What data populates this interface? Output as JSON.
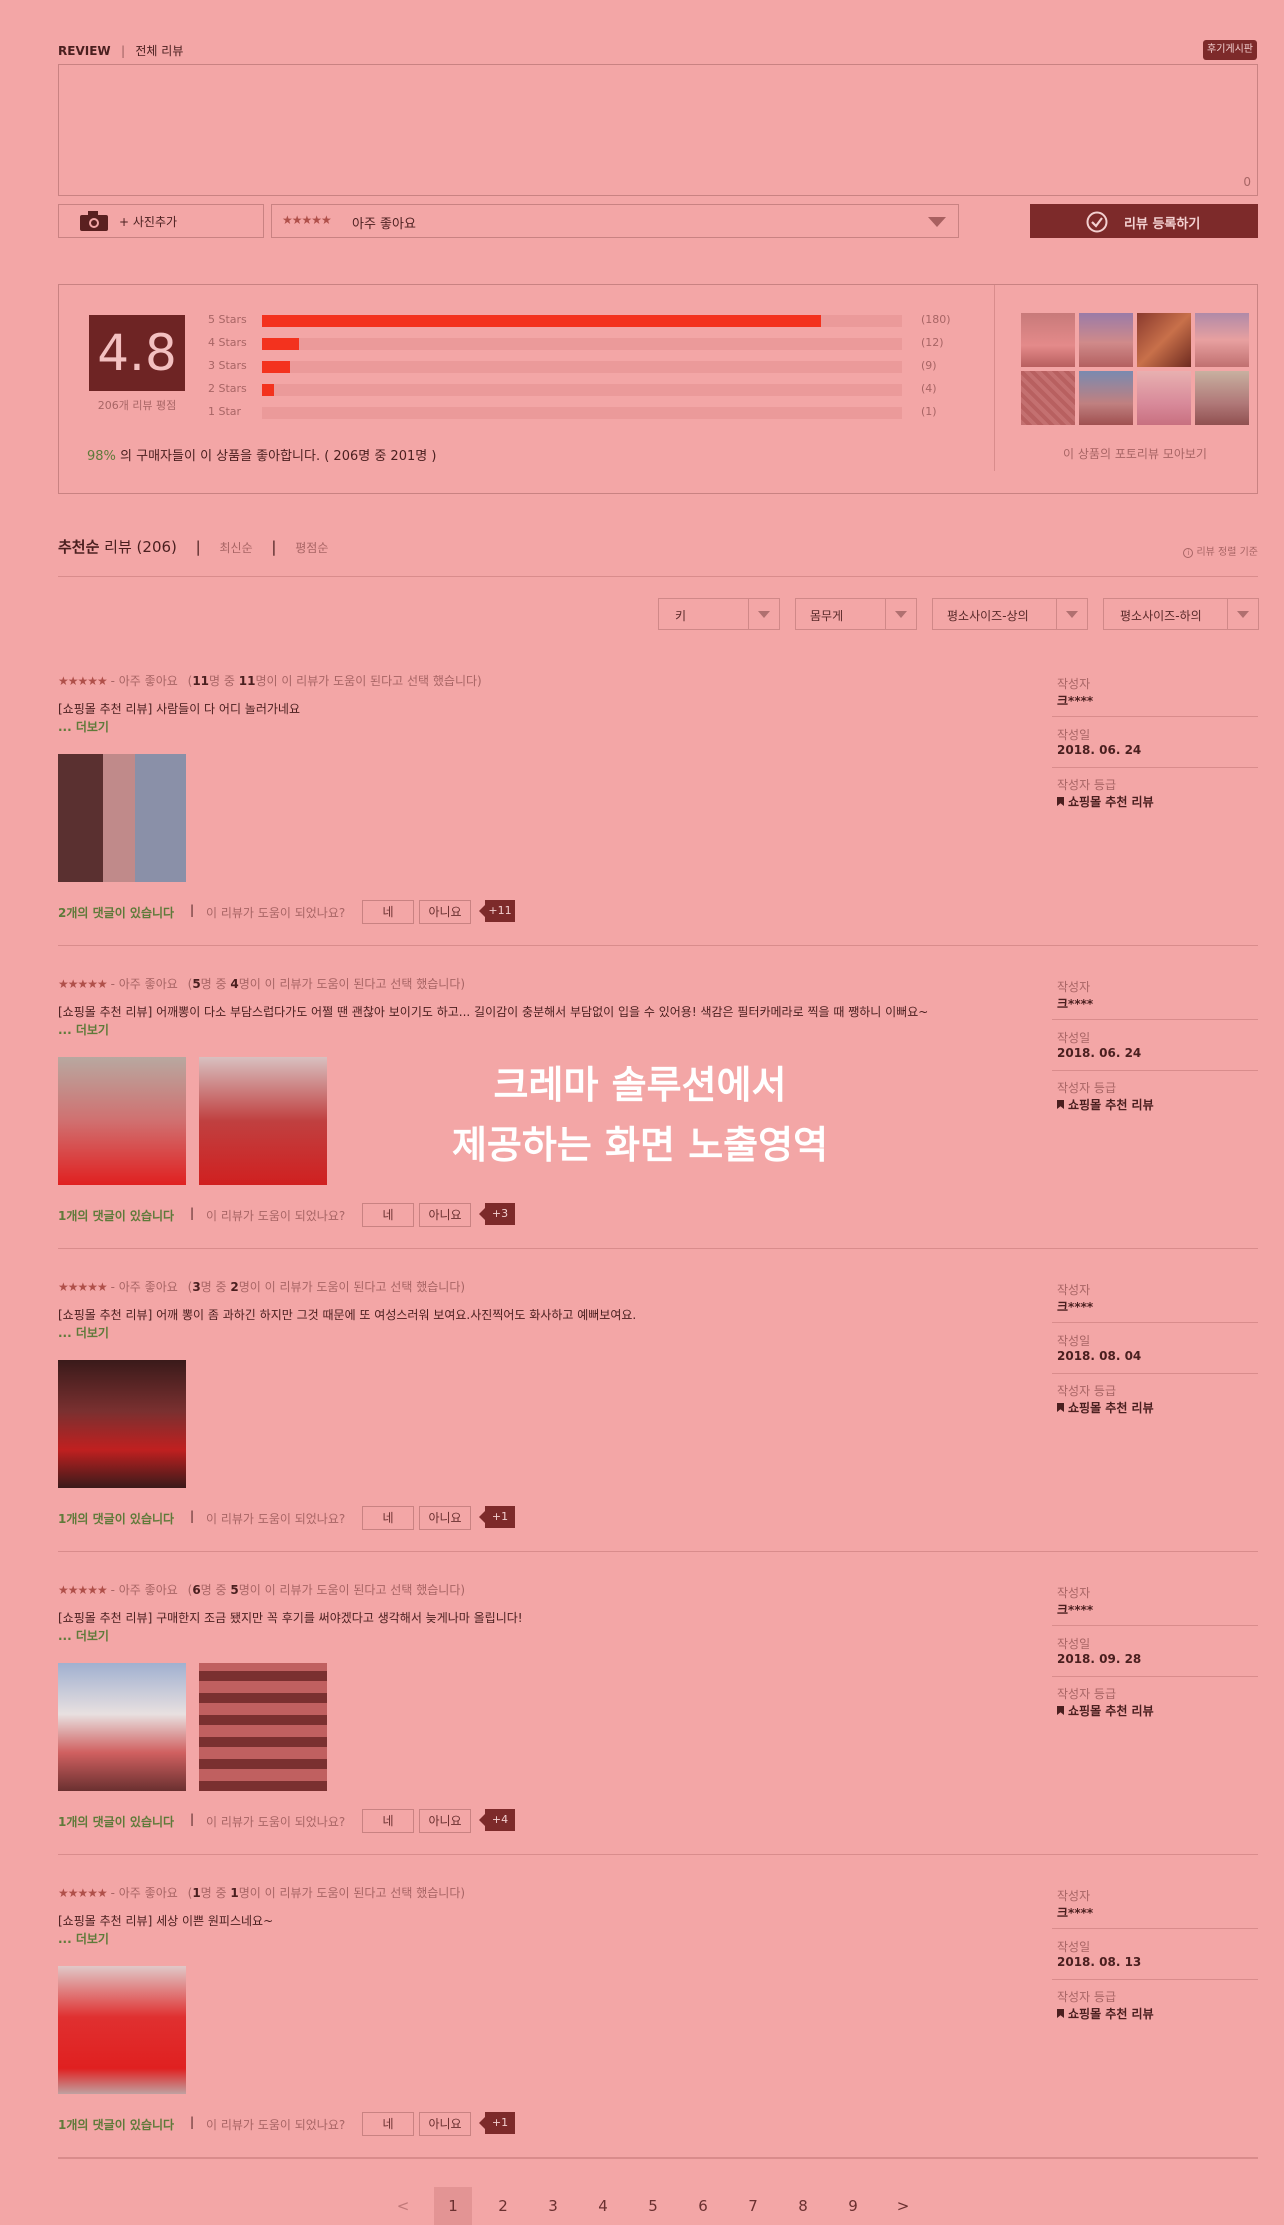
{
  "header": {
    "review_label": "REVIEW",
    "divider": "|",
    "all_reviews": "전체 리뷰",
    "board_button": "후기게시판"
  },
  "editor": {
    "char_count": "0",
    "add_photo": "+ 사진추가",
    "rating_stars": "★★★★★",
    "rating_label": "아주 좋아요",
    "submit": "리뷰 등록하기"
  },
  "summary": {
    "score": "4.8",
    "count_label": "206개 리뷰 평점",
    "bars": [
      {
        "label": "5 Stars",
        "count": "(180)",
        "ratio": 0.874
      },
      {
        "label": "4 Stars",
        "count": "(12)",
        "ratio": 0.058
      },
      {
        "label": "3 Stars",
        "count": "(9)",
        "ratio": 0.044
      },
      {
        "label": "2 Stars",
        "count": "(4)",
        "ratio": 0.019
      },
      {
        "label": "1 Star",
        "count": "(1)",
        "ratio": 0.0
      }
    ],
    "percent": "98%",
    "recommend_text": " 의 구매자들이 이 상품을 좋아합니다. ( 206명 중 201명 )",
    "photo_review_link": "이 상품의 포토리뷰 모아보기"
  },
  "sort": {
    "active_bold": "추천순",
    "active_rest": " 리뷰 (206)",
    "sep": "|",
    "latest": "최신순",
    "rating": "평점순",
    "criteria": "리뷰 정렬 기준",
    "info_icon": "info-circle-icon"
  },
  "filters": [
    "키",
    "몸무게",
    "평소사이즈-상의",
    "평소사이즈-하의"
  ],
  "side_labels": {
    "author": "작성자",
    "date": "작성일",
    "grade": "작성자 등급"
  },
  "reviews": [
    {
      "stars": "★★★★★",
      "rating_text": "- 아주 좋아요",
      "helpful_pre": "(",
      "helpful_a": "11",
      "helpful_mid": "명 중 ",
      "helpful_b": "11",
      "helpful_post": "명이 이 리뷰가 도움이 된다고 선택 했습니다)",
      "text": "[쇼핑몰 추천 리뷰] 사람들이 다 어디 놀러가네요",
      "more": "... 더보기",
      "comments": "2개의 댓글이 있습니다",
      "question": "이 리뷰가 도움이 되었나요?",
      "yes": "네",
      "no": "아니요",
      "count_badge": "+11",
      "author": "크****",
      "date": "2018. 06. 24",
      "grade": "쇼핑몰 추천 리뷰"
    },
    {
      "stars": "★★★★★",
      "rating_text": "- 아주 좋아요",
      "helpful_pre": "(",
      "helpful_a": "5",
      "helpful_mid": "명 중 ",
      "helpful_b": "4",
      "helpful_post": "명이 이 리뷰가 도움이 된다고 선택 했습니다)",
      "text": "[쇼핑몰 추천 리뷰] 어깨뽕이 다소 부담스럽다가도 어쩔 땐 괜찮아 보이기도 하고... 길이감이 충분해서 부담없이 입을 수 있어용! 색감은 필터카메라로 찍을 때 쨍하니 이뻐요~",
      "more": "... 더보기",
      "comments": "1개의 댓글이 있습니다",
      "question": "이 리뷰가 도움이 되었나요?",
      "yes": "네",
      "no": "아니요",
      "count_badge": "+3",
      "author": "크****",
      "date": "2018. 06. 24",
      "grade": "쇼핑몰 추천 리뷰"
    },
    {
      "stars": "★★★★★",
      "rating_text": "- 아주 좋아요",
      "helpful_pre": "(",
      "helpful_a": "3",
      "helpful_mid": "명 중 ",
      "helpful_b": "2",
      "helpful_post": "명이 이 리뷰가 도움이 된다고 선택 했습니다)",
      "text": "[쇼핑몰 추천 리뷰] 어깨 뽕이 좀 과하긴 하지만 그것 때문에 또 여성스러워 보여요.사진찍어도 화사하고 예뻐보여요.",
      "more": "... 더보기",
      "comments": "1개의 댓글이 있습니다",
      "question": "이 리뷰가 도움이 되었나요?",
      "yes": "네",
      "no": "아니요",
      "count_badge": "+1",
      "author": "크****",
      "date": "2018. 08. 04",
      "grade": "쇼핑몰 추천 리뷰"
    },
    {
      "stars": "★★★★★",
      "rating_text": "- 아주 좋아요",
      "helpful_pre": "(",
      "helpful_a": "6",
      "helpful_mid": "명 중 ",
      "helpful_b": "5",
      "helpful_post": "명이 이 리뷰가 도움이 된다고 선택 했습니다)",
      "text": "[쇼핑몰 추천 리뷰] 구매한지 조금 됐지만 꼭 후기를 써야겠다고 생각해서 늦게나마 올립니다!",
      "more": "... 더보기",
      "comments": "1개의 댓글이 있습니다",
      "question": "이 리뷰가 도움이 되었나요?",
      "yes": "네",
      "no": "아니요",
      "count_badge": "+4",
      "author": "크****",
      "date": "2018. 09. 28",
      "grade": "쇼핑몰 추천 리뷰"
    },
    {
      "stars": "★★★★★",
      "rating_text": "- 아주 좋아요",
      "helpful_pre": "(",
      "helpful_a": "1",
      "helpful_mid": "명 중 ",
      "helpful_b": "1",
      "helpful_post": "명이 이 리뷰가 도움이 된다고 선택 했습니다)",
      "text": "[쇼핑몰 추천 리뷰] 세상 이쁜 원피스네요~",
      "more": "... 더보기",
      "comments": "1개의 댓글이 있습니다",
      "question": "이 리뷰가 도움이 되었나요?",
      "yes": "네",
      "no": "아니요",
      "count_badge": "+1",
      "author": "크****",
      "date": "2018. 08. 13",
      "grade": "쇼핑몰 추천 리뷰"
    }
  ],
  "overlay": {
    "line1": "크레마 솔루션에서",
    "line2": "제공하는 화면 노출영역"
  },
  "pagination": {
    "prev": "<",
    "pages": [
      "1",
      "2",
      "3",
      "4",
      "5",
      "6",
      "7",
      "8",
      "9"
    ],
    "next": ">",
    "current": "1"
  },
  "colors": {
    "background": "#f3a6a6",
    "accent_dark": "#7d2a2a",
    "bar_fill": "#f3321e",
    "green_text": "#5f7a3a"
  }
}
